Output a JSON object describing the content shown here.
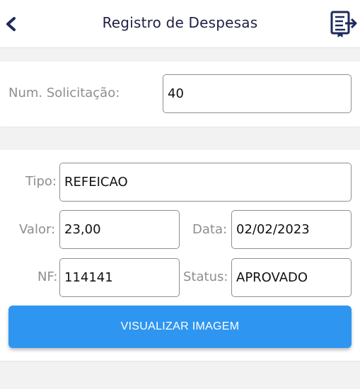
{
  "header": {
    "title": "Registro de Despesas",
    "back_icon": "chevron-left-icon",
    "export_icon": "document-export-icon",
    "accent": "#1f2a5c"
  },
  "request": {
    "num_label": "Num. Solicitação:",
    "num_value": "40"
  },
  "expense": {
    "tipo_label": "Tipo:",
    "tipo_value": "REFEICAO",
    "valor_label": "Valor:",
    "valor_value": "23,00",
    "data_label": "Data:",
    "data_value": "02/02/2023",
    "nf_label": "NF:",
    "nf_value": "114141",
    "status_label": "Status:",
    "status_value": "APROVADO"
  },
  "actions": {
    "view_image_label": "VISUALIZAR IMAGEM",
    "button_color": "#2e96f0"
  }
}
